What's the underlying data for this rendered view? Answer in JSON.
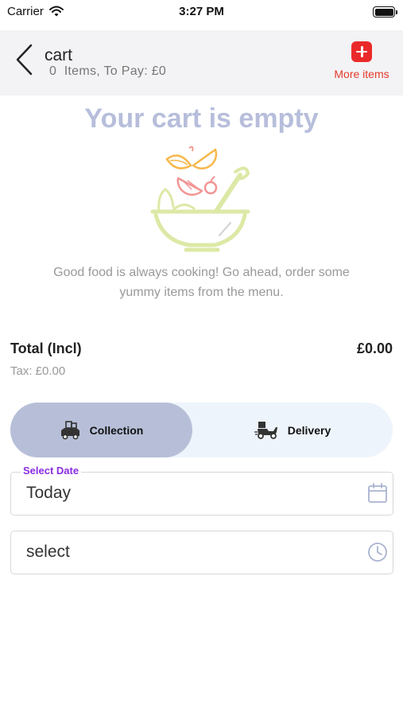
{
  "status_bar": {
    "carrier": "Carrier",
    "time": "3:27 PM"
  },
  "header": {
    "title": "cart",
    "subtitle": "0  Items, To Pay: £0",
    "more_items_label": "More items"
  },
  "empty_state": {
    "title": "Your cart is empty",
    "description": "Good food is always cooking! Go ahead, order some yummy items from the menu."
  },
  "totals": {
    "total_label": "Total (Incl)",
    "total_value": "£0.00",
    "tax": "Tax: £0.00"
  },
  "order_type": {
    "options": [
      {
        "label": "Collection",
        "icon": "collection-icon"
      },
      {
        "label": "Delivery",
        "icon": "delivery-icon"
      }
    ],
    "selected": "Collection",
    "active_color": "#b7bfd8"
  },
  "date_field": {
    "label": "Select Date",
    "value": "Today",
    "icon": "calendar-icon"
  },
  "time_field": {
    "value": "select",
    "icon": "clock-icon"
  },
  "colors": {
    "accent": "#ea2a2a",
    "label_purple": "#8b2be2",
    "empty_title": "#b7bedb"
  }
}
